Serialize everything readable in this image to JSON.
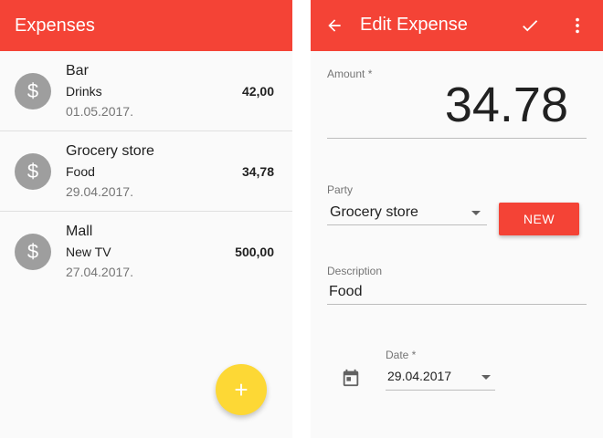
{
  "list_screen": {
    "title": "Expenses",
    "items": [
      {
        "title": "Bar",
        "category": "Drinks",
        "date": "01.05.2017.",
        "amount": "42,00"
      },
      {
        "title": "Grocery store",
        "category": "Food",
        "date": "29.04.2017.",
        "amount": "34,78"
      },
      {
        "title": "Mall",
        "category": "New TV",
        "date": "27.04.2017.",
        "amount": "500,00"
      }
    ],
    "avatar_glyph": "$",
    "fab_glyph": "+"
  },
  "edit_screen": {
    "title": "Edit Expense",
    "amount_label": "Amount *",
    "amount_value": "34.78",
    "party_label": "Party",
    "party_value": "Grocery store",
    "new_button_label": "NEW",
    "description_label": "Description",
    "description_value": "Food",
    "date_label": "Date *",
    "date_value": "29.04.2017"
  },
  "icons": {
    "back": "arrow-left-icon",
    "save": "check-icon",
    "more": "more-vertical-icon",
    "calendar": "calendar-icon",
    "currency": "dollar-icon",
    "add": "plus-icon",
    "dropdown": "caret-down-icon"
  },
  "colors": {
    "primary": "#f44336",
    "fab": "#fdd835",
    "avatar": "#9e9e9e"
  }
}
